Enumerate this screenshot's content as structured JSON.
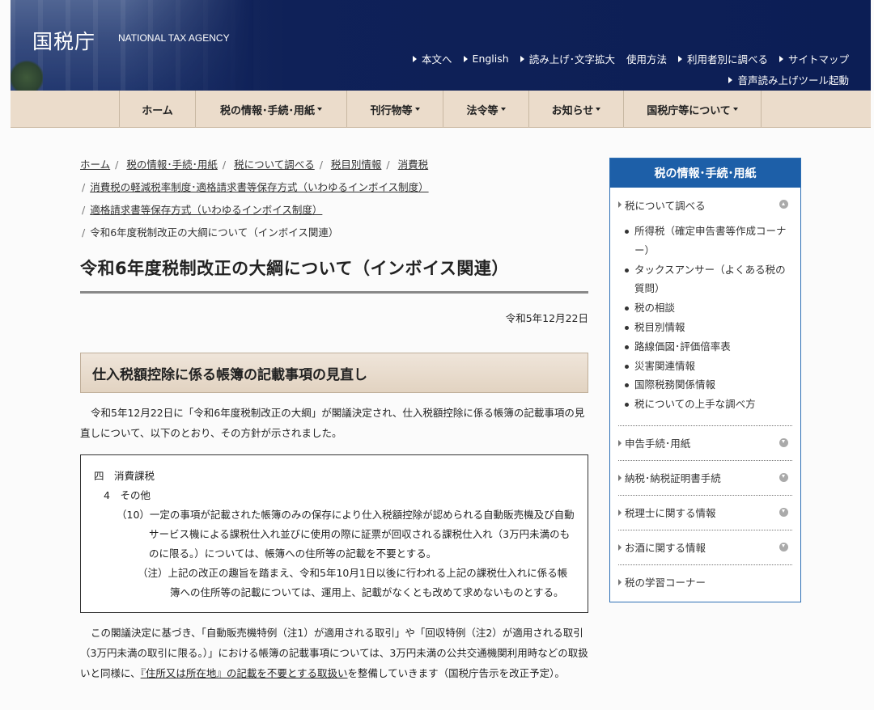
{
  "header": {
    "logo_jp": "国税庁",
    "logo_en": "NATIONAL TAX AGENCY",
    "util_links": [
      "本文へ",
      "English",
      "読み上げ･文字拡大",
      "使用方法",
      "利用者別に調べる",
      "サイトマップ"
    ],
    "util_link2": "音声読み上げツール起動"
  },
  "gnav": [
    "ホーム",
    "税の情報･手続･用紙",
    "刊行物等",
    "法令等",
    "お知らせ",
    "国税庁等について"
  ],
  "breadcrumb": [
    "ホーム",
    "税の情報･手続･用紙",
    "税について調べる",
    "税目別情報",
    "消費税",
    "消費税の軽減税率制度･適格請求書等保存方式（いわゆるインボイス制度）",
    "適格請求書等保存方式（いわゆるインボイス制度）",
    "令和6年度税制改正の大綱について（インボイス関連）"
  ],
  "page_title": "令和6年度税制改正の大綱について（インボイス関連）",
  "date": "令和5年12月22日",
  "section_title": "仕入税額控除に係る帳簿の記載事項の見直し",
  "intro": "令和5年12月22日に「令和6年度税制改正の大綱」が閣議決定され、仕入税額控除に係る帳簿の記載事項の見直しについて、以下のとおり、その方針が示されました。",
  "box": {
    "l1": "四　消費課税",
    "l2": "4　その他",
    "l3": "（10）一定の事項が記載された帳簿のみの保存により仕入税額控除が認められる自動販売機及び自動サービス機による課税仕入れ並びに使用の際に証票が回収される課税仕入れ（3万円未満のものに限る。）については、帳簿への住所等の記載を不要とする。",
    "l4": "（注）上記の改正の趣旨を踏まえ、令和5年10月1日以後に行われる上記の課税仕入れに係る帳簿への住所等の記載については、運用上、記載がなくとも改めて求めないものとする。"
  },
  "body2_a": "この閣議決定に基づき、「自動販売機特例（注1）が適用される取引」や「回収特例（注2）が適用される取引（3万円未満の取引に限る。）」における帳簿の記載事項については、3万円未満の公共交通機関利用時などの取扱いと同様に、",
  "body2_u": "『住所又は所在地』の記載を不要とする取扱い",
  "body2_b": "を整備していきます（国税庁告示を改正予定）。",
  "sidebar": {
    "heading": "税の情報･手続･用紙",
    "sec1_title": "税について調べる",
    "sec1_items": [
      "所得税（確定申告書等作成コーナー）",
      "タックスアンサー（よくある税の質問）",
      "税の相談",
      "税目別情報",
      "路線価図･評価倍率表",
      "災害関連情報",
      "国際税務関係情報",
      "税についての上手な調べ方"
    ],
    "sections": [
      "申告手続･用紙",
      "納税･納税証明書手続",
      "税理士に関する情報",
      "お酒に関する情報",
      "税の学習コーナー"
    ]
  }
}
